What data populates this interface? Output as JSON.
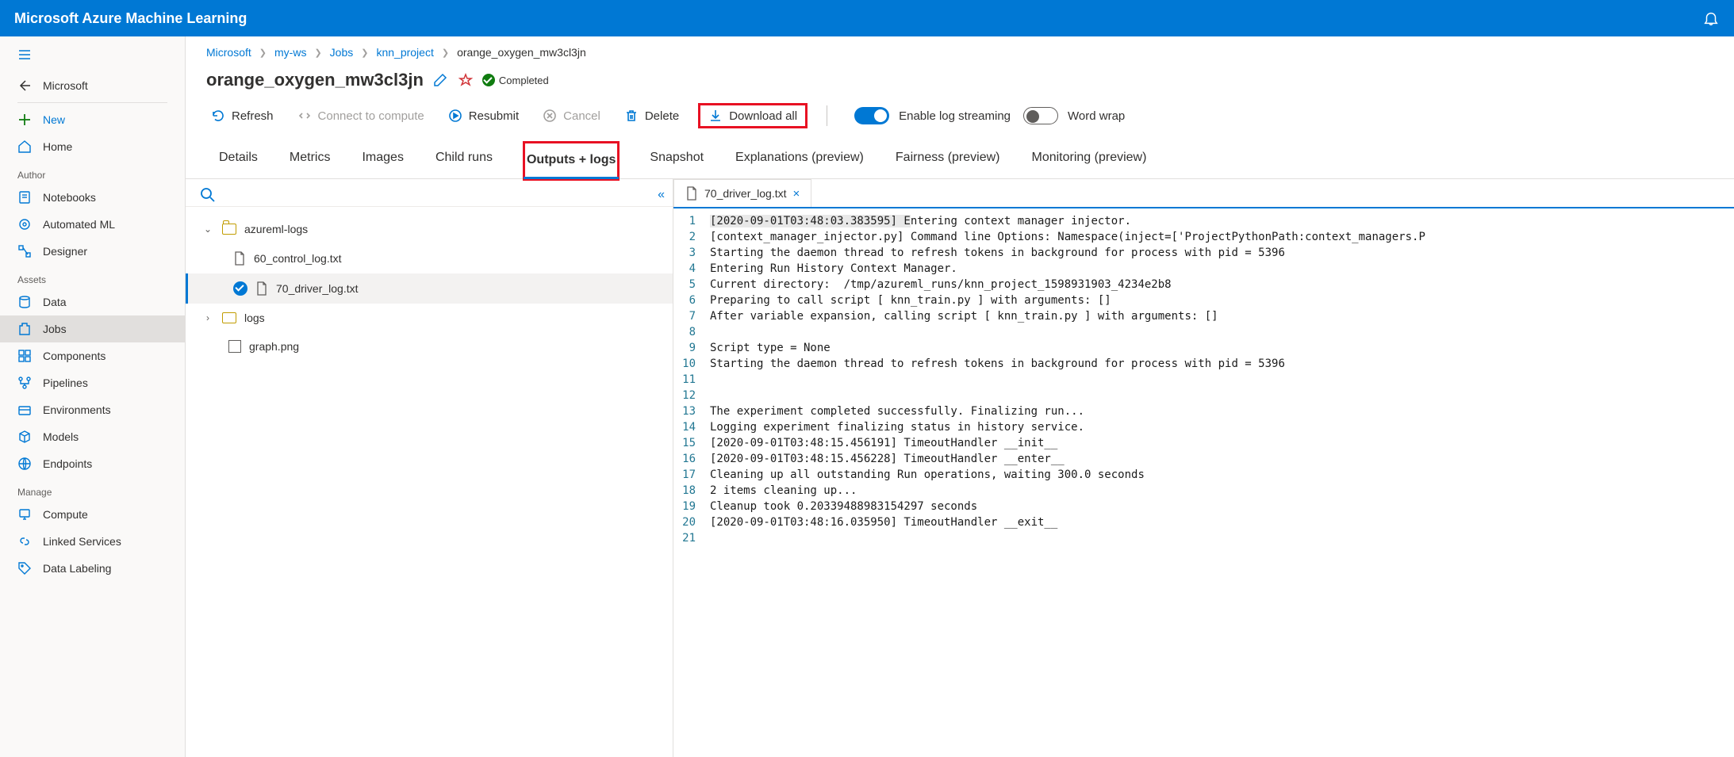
{
  "app": {
    "title": "Microsoft Azure Machine Learning"
  },
  "nav": {
    "back_label": "Microsoft",
    "new_label": "New",
    "home_label": "Home",
    "section_author": "Author",
    "notebooks": "Notebooks",
    "automl": "Automated ML",
    "designer": "Designer",
    "section_assets": "Assets",
    "data": "Data",
    "jobs": "Jobs",
    "components": "Components",
    "pipelines": "Pipelines",
    "environments": "Environments",
    "models": "Models",
    "endpoints": "Endpoints",
    "section_manage": "Manage",
    "compute": "Compute",
    "linked": "Linked Services",
    "labeling": "Data Labeling"
  },
  "breadcrumb": {
    "c0": "Microsoft",
    "c1": "my-ws",
    "c2": "Jobs",
    "c3": "knn_project",
    "c4": "orange_oxygen_mw3cl3jn"
  },
  "job": {
    "name": "orange_oxygen_mw3cl3jn",
    "status": "Completed"
  },
  "actions": {
    "refresh": "Refresh",
    "connect": "Connect to compute",
    "resubmit": "Resubmit",
    "cancel": "Cancel",
    "delete": "Delete",
    "download": "Download all",
    "enable_log_streaming": "Enable log streaming",
    "word_wrap": "Word wrap"
  },
  "tabs": {
    "details": "Details",
    "metrics": "Metrics",
    "images": "Images",
    "child_runs": "Child runs",
    "outputs_logs": "Outputs + logs",
    "snapshot": "Snapshot",
    "explanations": "Explanations (preview)",
    "fairness": "Fairness (preview)",
    "monitoring": "Monitoring (preview)"
  },
  "tree": {
    "folder_azureml_logs": "azureml-logs",
    "file_60": "60_control_log.txt",
    "file_70": "70_driver_log.txt",
    "folder_logs": "logs",
    "file_graph": "graph.png"
  },
  "editor": {
    "active_tab": "70_driver_log.txt",
    "lines": [
      {
        "n": "1",
        "text": "[2020-09-01T03:48:03.383595] Entering context manager injector.",
        "hl": [
          0,
          30
        ]
      },
      {
        "n": "2",
        "text": "[context_manager_injector.py] Command line Options: Namespace(inject=['ProjectPythonPath:context_managers.P"
      },
      {
        "n": "3",
        "text": "Starting the daemon thread to refresh tokens in background for process with pid = 5396"
      },
      {
        "n": "4",
        "text": "Entering Run History Context Manager."
      },
      {
        "n": "5",
        "text": "Current directory:  /tmp/azureml_runs/knn_project_1598931903_4234e2b8"
      },
      {
        "n": "6",
        "text": "Preparing to call script [ knn_train.py ] with arguments: []"
      },
      {
        "n": "7",
        "text": "After variable expansion, calling script [ knn_train.py ] with arguments: []"
      },
      {
        "n": "8",
        "text": ""
      },
      {
        "n": "9",
        "text": "Script type = None"
      },
      {
        "n": "10",
        "text": "Starting the daemon thread to refresh tokens in background for process with pid = 5396"
      },
      {
        "n": "11",
        "text": ""
      },
      {
        "n": "12",
        "text": ""
      },
      {
        "n": "13",
        "text": "The experiment completed successfully. Finalizing run..."
      },
      {
        "n": "14",
        "text": "Logging experiment finalizing status in history service."
      },
      {
        "n": "15",
        "text": "[2020-09-01T03:48:15.456191] TimeoutHandler __init__"
      },
      {
        "n": "16",
        "text": "[2020-09-01T03:48:15.456228] TimeoutHandler __enter__"
      },
      {
        "n": "17",
        "text": "Cleaning up all outstanding Run operations, waiting 300.0 seconds"
      },
      {
        "n": "18",
        "text": "2 items cleaning up..."
      },
      {
        "n": "19",
        "text": "Cleanup took 0.20339488983154297 seconds"
      },
      {
        "n": "20",
        "text": "[2020-09-01T03:48:16.035950] TimeoutHandler __exit__"
      },
      {
        "n": "21",
        "text": ""
      }
    ]
  }
}
